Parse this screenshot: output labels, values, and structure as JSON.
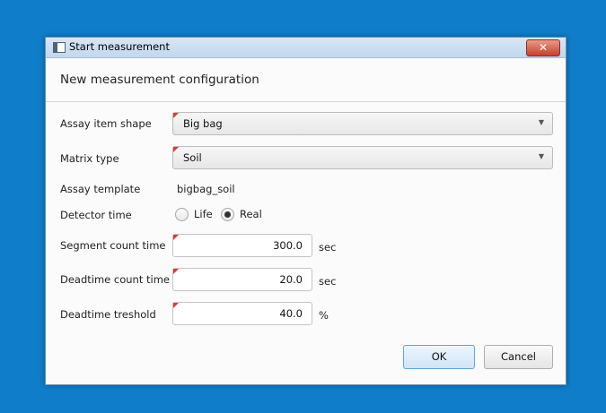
{
  "window": {
    "title": "Start measurement",
    "close_glyph": "✕"
  },
  "header": {
    "text": "New measurement configuration"
  },
  "form": {
    "assay_item_shape": {
      "label": "Assay item shape",
      "value": "Big bag"
    },
    "matrix_type": {
      "label": "Matrix type",
      "value": "Soil"
    },
    "assay_template": {
      "label": "Assay template",
      "value": "bigbag_soil"
    },
    "detector_time": {
      "label": "Detector time",
      "options": [
        "Life",
        "Real"
      ],
      "selected": "Real"
    },
    "segment_count_time": {
      "label": "Segment count time",
      "value": "300.0",
      "unit": "sec"
    },
    "deadtime_count_time": {
      "label": "Deadtime count time",
      "value": "20.0",
      "unit": "sec"
    },
    "deadtime_treshold": {
      "label": "Deadtime treshold",
      "value": "40.0",
      "unit": "%"
    }
  },
  "buttons": {
    "ok": "OK",
    "cancel": "Cancel"
  },
  "colors": {
    "desktop": "#0f7dc9",
    "required_marker": "#e03a2f",
    "ok_border": "#5ea5d8"
  }
}
